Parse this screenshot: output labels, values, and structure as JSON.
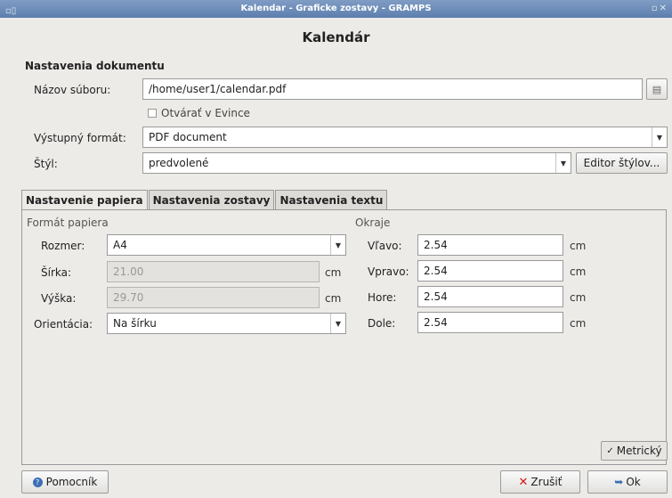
{
  "window": {
    "title": "Kalendar - Graficke zostavy - GRAMPS"
  },
  "dialog": {
    "heading": "Kalendár"
  },
  "document": {
    "section_title": "Nastavenia dokumentu",
    "filename_label": "Názov súboru:",
    "filename_value": "/home/user1/calendar.pdf",
    "open_evince_label": "Otvárať v Evince",
    "output_format_label": "Výstupný formát:",
    "output_format_value": "PDF document",
    "style_label": "Štýl:",
    "style_value": "predvolené",
    "style_editor_button": "Editor štýlov..."
  },
  "tabs": [
    "Nastavenie papiera",
    "Nastavenia zostavy",
    "Nastavenia textu"
  ],
  "paper": {
    "format_title": "Formát papiera",
    "size_label": "Rozmer:",
    "size_value": "A4",
    "width_label": "Šírka:",
    "width_value": "21.00",
    "height_label": "Výška:",
    "height_value": "29.70",
    "orientation_label": "Orientácia:",
    "orientation_value": "Na šírku",
    "unit": "cm"
  },
  "margins": {
    "title": "Okraje",
    "left_label": "Vľavo:",
    "left_value": "2.54",
    "right_label": "Vpravo:",
    "right_value": "2.54",
    "top_label": "Hore:",
    "top_value": "2.54",
    "bottom_label": "Dole:",
    "bottom_value": "2.54",
    "unit": "cm"
  },
  "metric_label": "Metrický",
  "buttons": {
    "help": "Pomocník",
    "cancel": "Zrušiť",
    "ok": "Ok"
  }
}
